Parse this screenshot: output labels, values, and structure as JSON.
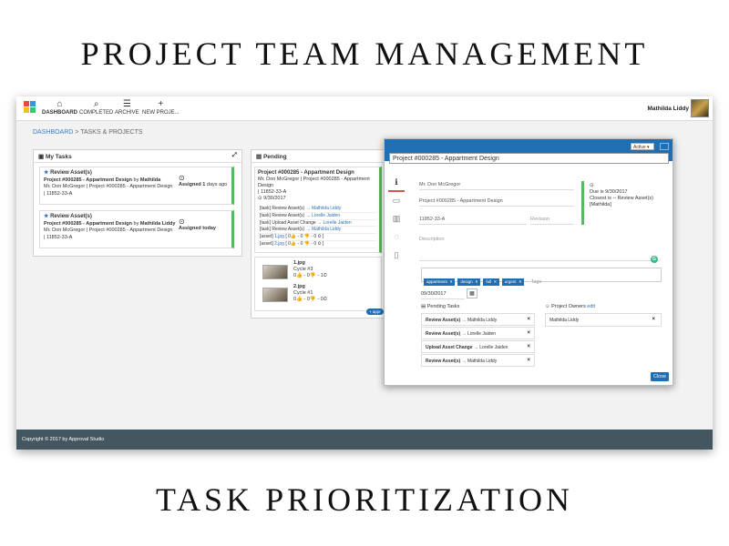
{
  "headings": {
    "top": "PROJECT TEAM MANAGEMENT",
    "bottom": "TASK PRIORITIZATION"
  },
  "nav": {
    "items": [
      {
        "label": "DASHBOARD",
        "icon": "home-icon"
      },
      {
        "label": "COMPLETED",
        "icon": "search-icon"
      },
      {
        "label": "ARCHIVE",
        "icon": "database-icon"
      },
      {
        "label": "NEW PROJE...",
        "icon": "plus-icon"
      }
    ]
  },
  "user": {
    "name": "Mathilda Liddy"
  },
  "breadcrumb": {
    "root": "DASHBOARD",
    "current": "> TASKS & PROJECTS"
  },
  "my_tasks": {
    "title": "My Tasks",
    "cards": [
      {
        "title": "Review Asset(s)",
        "project_line": "Project #000285 - Appartment Design",
        "by_text": "by",
        "by_name": "Mathilda",
        "detail": "Mr. Don McGregor | Project #000285 - Appartment Design",
        "code": "| 11852-33-A",
        "assigned_label": "Assigned",
        "assigned_value": "1",
        "assigned_suffix": "days ago"
      },
      {
        "title": "Review Asset(s)",
        "project_line": "Project #000285 - Appartment Design",
        "by_text": "by",
        "by_name": "Mathilda Liddy",
        "detail": "Mr. Don McGregor | Project #000285 - Appartment Design",
        "code": "| 11852-33-A",
        "assigned_label": "Assigned",
        "assigned_value": "today",
        "assigned_suffix": ""
      }
    ]
  },
  "pending": {
    "title": "Pending",
    "project": "Project #000285 - Appartment Design",
    "detail": "Mr. Don McGregor | Project #000285 - Appartment Design",
    "code": "| 11852-33-A",
    "date": "9/30/2017",
    "lines": [
      {
        "tag": "[task]",
        "text": "Review Asset(s)",
        "name": "Mathilda Liddy"
      },
      {
        "tag": "[task]",
        "text": "Review Asset(s)",
        "name": "Lorelle Jaiden"
      },
      {
        "tag": "[task]",
        "text": "Upload Asset Change",
        "name": "Lorelle Jaiden"
      },
      {
        "tag": "[task]",
        "text": "Review Asset(s)",
        "name": "Mathilda Liddy"
      },
      {
        "tag": "[asset]",
        "text": "1.jpg",
        "name": "[ 0👍 - 0 👎 - 0 ⏲ ]"
      },
      {
        "tag": "[asset]",
        "text": "2.jpg",
        "name": "[ 0👍 - 0 👎 - 0 ⏲ ]"
      }
    ],
    "assets": [
      {
        "name": "1.jpg",
        "cycle": "Cycle #3",
        "stats": "0👍 - 0👎 - 1⏲"
      },
      {
        "name": "2.jpg",
        "cycle": "Cycle #1",
        "stats": "0👍 - 0👎 - 0⏲"
      }
    ],
    "badge": "+ appr"
  },
  "modal": {
    "status": "Active",
    "title": "Project #000285 - Appartment Design",
    "client": "Mr. Don McGregor",
    "project": "Project #000285 - Appartment Design",
    "code": "11852-33-A",
    "revision_placeholder": "Revision",
    "description_placeholder": "Description",
    "due_line": "Due is 9/30/2017",
    "closest_line": "Closest is -- Review Asset(s)",
    "closest_name": "[Mathilda]",
    "tags": [
      "appartment",
      "design",
      "full",
      "urgent"
    ],
    "tags_placeholder": "Tags",
    "date": "09/30/2017",
    "pending_tasks_title": "Pending Tasks",
    "pending_tasks": [
      {
        "task": "Review Asset(s)",
        "arrow": "→",
        "person": "Mathilda Liddy"
      },
      {
        "task": "Review Asset(s)",
        "arrow": "→",
        "person": "Lorelle Jaiden"
      },
      {
        "task": "Upload Asset Change",
        "arrow": "→",
        "person": "Lorelle Jaiden"
      },
      {
        "task": "Review Asset(s)",
        "arrow": "→",
        "person": "Mathilda Liddy"
      }
    ],
    "owners_title": "Project Owners",
    "owners_edit": "edit",
    "owners": [
      "Mathilda Liddy"
    ],
    "close_label": "Close"
  },
  "footer": {
    "text": "Copyright © 2017 by Approval Studio"
  },
  "colors": {
    "brand_blue": "#1f6fb5",
    "success_green": "#5cb85c",
    "footer_bg": "#445760",
    "danger_red": "#d9534f"
  }
}
